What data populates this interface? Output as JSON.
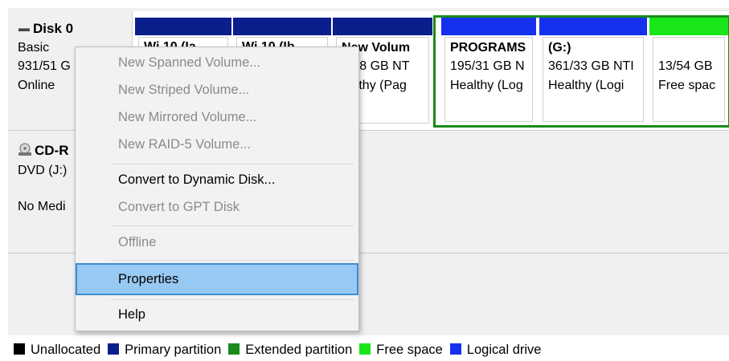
{
  "colors": {
    "primary": "#0a1f8c",
    "extended": "#1b8a1b",
    "logical": "#1530ee",
    "free": "#19e619",
    "unallocated": "#000000",
    "highlight": "#98c9f3"
  },
  "disk0": {
    "name": "Disk 0",
    "type": "Basic",
    "size": "931/51 G",
    "status": "Online",
    "icon": "disk-icon"
  },
  "cdrom": {
    "name": "CD-R",
    "type": "DVD (J:)",
    "status": "No Medi",
    "icon": "cd-drive-icon"
  },
  "partitions": [
    {
      "line1": "Wi 10 (Ia",
      "line2": "",
      "line3": ""
    },
    {
      "line1": "Wi 10 (Ib",
      "line2": "",
      "line3": ""
    },
    {
      "line1": "New Volum",
      "line2": "6/48 GB NT",
      "line3": "ealthy (Pag"
    },
    {
      "line1": "PROGRAMS",
      "line2": "195/31 GB N",
      "line3": "Healthy (Log"
    },
    {
      "line1": "(G:)",
      "line2": "361/33 GB NTI",
      "line3": "Healthy (Logi"
    },
    {
      "line1": "",
      "line2": "13/54 GB",
      "line3": "Free spac"
    }
  ],
  "menu": {
    "new_spanned": "New Spanned Volume...",
    "new_striped": "New Striped Volume...",
    "new_mirrored": "New Mirrored Volume...",
    "new_raid5": "New RAID-5 Volume...",
    "convert_dynamic": "Convert to Dynamic Disk...",
    "convert_gpt": "Convert to GPT Disk",
    "offline": "Offline",
    "properties": "Properties",
    "help": "Help"
  },
  "legend": [
    {
      "label": "Unallocated",
      "color": "#000000"
    },
    {
      "label": "Primary partition",
      "color": "#0a1f8c"
    },
    {
      "label": "Extended partition",
      "color": "#1b8a1b"
    },
    {
      "label": "Free space",
      "color": "#19e619"
    },
    {
      "label": "Logical drive",
      "color": "#1530ee"
    }
  ]
}
